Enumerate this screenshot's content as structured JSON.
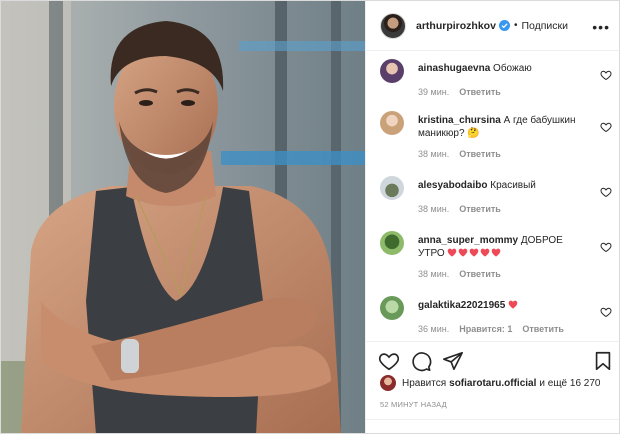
{
  "post": {
    "username": "arthurpirozhkov",
    "follow_label": "Подписки",
    "more_label": "•••",
    "photo_icon": "portrait-photo"
  },
  "comments": [
    {
      "user": "ainashugaevna",
      "text": "Обожаю",
      "time": "39 мин.",
      "reply": "Ответить",
      "likes": ""
    },
    {
      "user": "kristina_chursina",
      "text": "А где бабушкин маникюр? 🤔",
      "time": "38 мин.",
      "reply": "Ответить",
      "likes": ""
    },
    {
      "user": "alesyabodaibo",
      "text": "Красивый",
      "time": "38 мин.",
      "reply": "Ответить",
      "likes": ""
    },
    {
      "user": "anna_super_mommy",
      "text": "ДОБРОЕ УТРО",
      "hearts": 5,
      "time": "38 мин.",
      "reply": "Ответить",
      "likes": ""
    },
    {
      "user": "galaktika22021965",
      "text": "",
      "hearts": 1,
      "time": "36 мин.",
      "reply": "Ответить",
      "likes": "Нравится: 1"
    }
  ],
  "likes": {
    "prefix": "Нравится",
    "user": "sofiarotaru.official",
    "suffix": "и ещё 16 270"
  },
  "timestamp": "52 МИНУТ НАЗАД",
  "colors": {
    "heart_red": "#ed4956",
    "verified_blue": "#3897f0",
    "muted": "#8e8e8e"
  }
}
